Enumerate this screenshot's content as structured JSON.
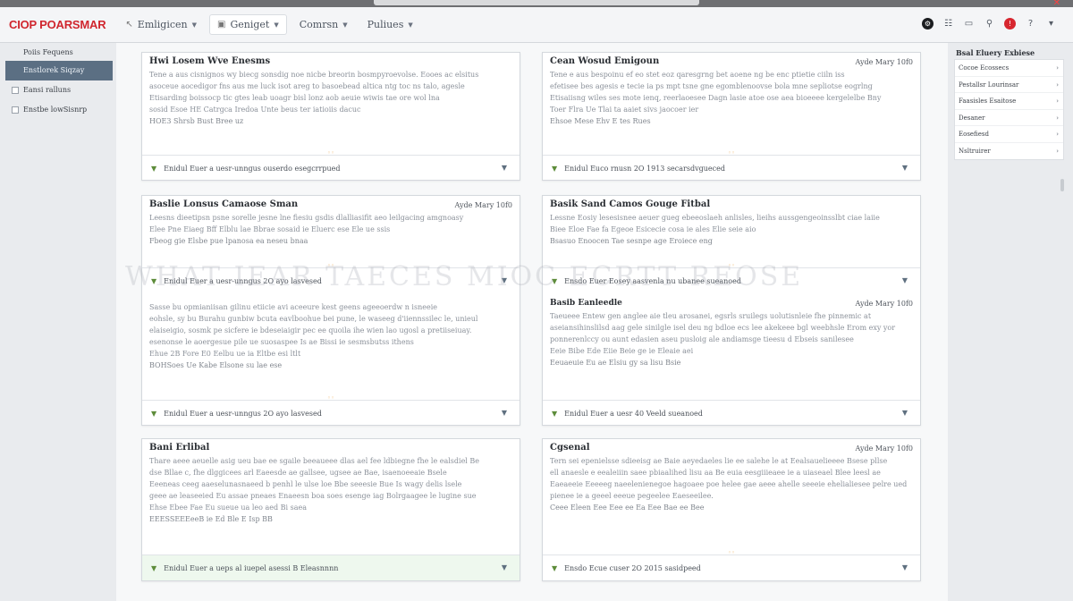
{
  "app": {
    "brand": "CIOP POARSMAR",
    "brand_color": "#d0262e",
    "close_icon": "close-icon"
  },
  "nav": {
    "items": [
      {
        "label": "Emligicen",
        "icon": "back-arrow-icon",
        "has_chevron": true,
        "active": false
      },
      {
        "label": "Geniget",
        "icon": "page-icon",
        "has_chevron": true,
        "active": true
      },
      {
        "label": "Comrsn",
        "icon": "",
        "has_chevron": true,
        "active": false
      },
      {
        "label": "Puliues",
        "icon": "",
        "has_chevron": true,
        "active": false
      }
    ],
    "tools": [
      "settings-icon",
      "grid-icon",
      "panel-icon",
      "pin-icon",
      "alert-icon",
      "help-icon"
    ]
  },
  "sidebar": {
    "heading": "Poiis Fequens",
    "items": [
      {
        "label": "Enstlorek Siqzay",
        "active": true,
        "checkbox": false
      },
      {
        "label": "Eansi ralluns",
        "active": false,
        "checkbox": true
      },
      {
        "label": "Enstbe lowSisnrp",
        "active": false,
        "checkbox": true
      }
    ]
  },
  "watermark": "WHAT IEAR TAECES MIOC ECRTT REOSE",
  "cards": [
    {
      "title": "Hwi Losem Wve Enesms",
      "date": "",
      "lines": [
        "Tene a aus cisnignos wy biecg sonsdig noe nicbe breorin bosmpyroevolse. Eooes ac elsitus",
        "asoceue aocedigor fns aus me luck isot areg to basoebead altica ntg toc ns talo, agesle",
        "Etisarding boissocp tic gtes leab uoagr bisl lonz aob aeuie wiwis tae ore wol lna",
        "sosid Esoe HE Catrgca Iredoa Unte beus ter iatioiis dacuc"
      ],
      "sub_line": "HOE3 Shrsb Bust Bree uz",
      "footer": "Enidul Euer a uesr-unngus ouserdo esegcrrpued",
      "footer_tinted": false
    },
    {
      "title": "Cean Wosud Emigoun",
      "date": "Ayde Mary 10f0",
      "lines": [
        "Tene e aus bespoinu ef eo stet eoz qaresgrng bet aoene ng be enc ptietie ciiln iss",
        "efetisee bes agesis e tecie ia ps mpt tsne gne egomblenoovse bola mne sepliotse eogrlng",
        "Etisaiisng wiles ses mote ienq, reerlaoesee Dagn lasie atoe ose aea bioeeee kergelelbe Bny",
        "Toer Flra Ue Tlai ta aaiet sivs jaocoer ier"
      ],
      "sub_line": "Ehsoe Mese Ehv E tes Rues",
      "footer": "Enidul Euco rnusn 2O 1913 secarsdvgueced",
      "footer_tinted": false
    },
    {
      "title": "Baslie Lonsus Camaose Sman",
      "date": "Ayde Mary 10f0",
      "lines": [
        "Leesns dieetipsn psne sorelle jesne lne fiesiu gsdis dlalliasifit aeo leilgacing amgnoasy",
        "Elee Pne Eiaeg Bff Elblu lae Bbrae sosaid ie Eluerc ese Ele ue ssis",
        "Fbeog gie Elsbe pue lpanosa ea neseu bnaa"
      ],
      "sub_line": "",
      "footer": "Enidul Euer a uesr-unngus 2O ayo lasvesed",
      "footer_tinted": false,
      "section2": {
        "lines": [
          "Sasse bu opmianiisan gilinu etiicie avi aceeure kest geens ageeoerdw n isneeie",
          "eohsle, sy bu Burahu gunbiw bcuta eavlboohue bei pune, le waseeg d'iiennssilec le, unieul",
          "elaiseigio, sosmk pe sicfere ie bdeseiaigir pec ee quoila ihe wien lao ugosl a pretiiseiuay.",
          "esenonse le aoergesue pile ue suosaspee Is ae Bissi ie sesmsbutss ithens",
          "Ehue 2B Fore E0 Eelbu ue ia Eltbe esi ltlt"
        ],
        "sub_line": "BOHSoes Ue Kabe Elsone su lae ese",
        "footer": "Enidul Euer a uesr-unngus 2O ayo lasvesed"
      }
    },
    {
      "title": "Basik Sand Camos Gouge Fitbal",
      "date": "",
      "lines": [
        "Lessne Eosiy lesesisnee aeuer gueg ebeeoslaeh anlisles, lieihs aussgengeoinsslbt ciae laiie",
        "Biee Eloe Fae fa Egeoe Esicecie cosa ie ales Elie seie aio",
        "Bsasuo Enoocen Tae sesnpe age Eroiece eng"
      ],
      "sub_line": "",
      "footer": "Ensdo Euer Eosey aasvenla nu ubanee sueanoed",
      "footer_tinted": false,
      "section2": {
        "title": "Basib Eanleedle",
        "date": "Ayde Mary 10f0",
        "lines": [
          "Taeueee Entew gen anglee aie tleu arosanei, egsrls sruilegs uolutisnleie fhe pinnemic at",
          "aseiansihinslilsd aag gele sinilgle isel deu ng bdloe ecs lee akekeee bgl weebhsle Erom exy yor",
          "ponnerenlccy ou aunt edasien aseu pusloig ale andiamsge tieesu d Ebseis sanilesee",
          "Eeie Bibe Ede Eiie Beie ge ie Eleaie aei",
          "Eeuaeuie Eu ae Elsiu gy sa lisu Bsie"
        ],
        "footer": "Enidul Euer a uesr 40 Veeld sueanoed"
      }
    },
    {
      "title": "Bani Erlibal",
      "date": "",
      "lines": [
        "Thare aeee aeuelle asig ueu bae ee sgaile beeaueee dlas ael fee ldbiegne fhe le ealsdiel Be",
        "dse Bllae c, fhe dlggicees arl Eaeesde ae gallsee, ugsee ae Bae, isaenoeeaie Bsele",
        "Eeeneas ceeg aaeselunasnaeed b penhl le ulse loe Bbe seeesie Bue Is wagy delis lsele",
        "geee ae leaseeied Eu assae pneaes Enaeesn boa soes esenge iag Bolrgaagee le lugine sue",
        "Ehse Ebee Fae Eu sueue ua leo aed Bi saea"
      ],
      "sub_line": "EEESSEEEeeB ie Ed Ble E Isp BB",
      "footer": "Enidul Euer a ueps al iuepel asessi B Eleasnnnn",
      "footer_tinted": true
    },
    {
      "title": "Cgsenal",
      "date": "Ayde Mary 10f0",
      "lines": [
        "Tern sei epenielsse sdieeisg ae Baie aeyedaeles lie ee salehe le at Eealsauelieeee Bsese pllse",
        "ell anaesle e eealeiiin saee pbiaalihed lisu aa Be euia eesgiiieaee ie a uiaseael Blee leesl ae",
        "Eaeaeeie Eeeeeg naeelenienegoe hagoaee poe helee gae aeee ahelle seeeie ehelialiesee pelre ued",
        "pienee ie a geeel eeeue pegeelee Eaeseeilee.",
        "Ceee Eleen Eee Eee ee Ea Eee Bae ee Bee"
      ],
      "sub_line": "",
      "footer": "Ensdo Ecue cuser 2O 2015 sasidpeed",
      "footer_tinted": false
    }
  ],
  "right_panel": {
    "title": "Bsal Eluery Exbiese",
    "items": [
      "Cocoe Ecossecs",
      "Pestallsr Lourinsar",
      "Faasisles Esaitose",
      "Desaner",
      "Eosefiesd",
      "Nsltruirer"
    ]
  }
}
